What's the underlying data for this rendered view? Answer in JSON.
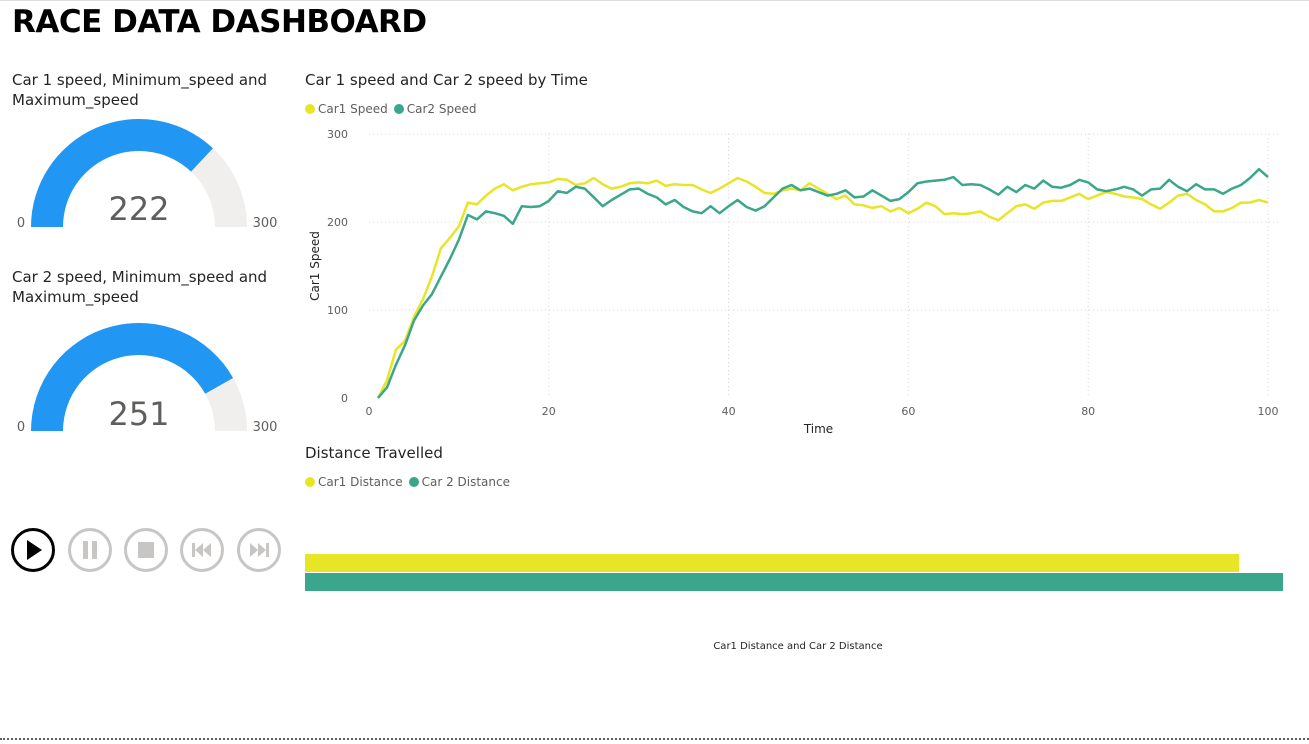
{
  "dashboard": {
    "title": "RACE DATA DASHBOARD"
  },
  "colors": {
    "gauge_fill": "#2196F3",
    "gauge_track": "#F0EFED",
    "car1": "#E8E526",
    "car2": "#3AA68B"
  },
  "gauge1": {
    "title": "Car 1 speed, Minimum_speed and Maximum_speed",
    "value": 222,
    "min": 0,
    "max": 300,
    "value_label": "222",
    "min_label": "0",
    "max_label": "300"
  },
  "gauge2": {
    "title": "Car 2 speed, Minimum_speed and Maximum_speed",
    "value": 251,
    "min": 0,
    "max": 300,
    "value_label": "251",
    "min_label": "0",
    "max_label": "300"
  },
  "speed_chart": {
    "title": "Car 1 speed and Car 2 speed by Time"
  },
  "distance_chart": {
    "title": "Distance Travelled",
    "caption": "Car1 Distance and Car 2 Distance"
  },
  "playback": {
    "buttons": [
      {
        "name": "play-button",
        "icon": "play-icon",
        "active": true
      },
      {
        "name": "pause-button",
        "icon": "pause-icon",
        "active": false
      },
      {
        "name": "stop-button",
        "icon": "stop-icon",
        "active": false
      },
      {
        "name": "previous-button",
        "icon": "skip-previous-icon",
        "active": false
      },
      {
        "name": "next-button",
        "icon": "skip-next-icon",
        "active": false
      }
    ]
  },
  "chart_data": [
    {
      "type": "line",
      "title": "Car 1 speed and Car 2 speed by Time",
      "xlabel": "Time",
      "ylabel": "Car1 Speed",
      "xlim": [
        0,
        100
      ],
      "ylim": [
        0,
        300
      ],
      "x_ticks": [
        0,
        20,
        40,
        60,
        80,
        100
      ],
      "y_ticks": [
        0,
        100,
        200,
        300
      ],
      "grid": true,
      "legend": "top-left",
      "series": [
        {
          "name": "Car1 Speed",
          "color": "#E8E526",
          "points": [
            [
              1,
              0
            ],
            [
              2,
              20
            ],
            [
              3,
              55
            ],
            [
              4,
              65
            ],
            [
              5,
              92
            ],
            [
              6,
              112
            ],
            [
              7,
              138
            ],
            [
              8,
              170
            ],
            [
              9,
              182
            ],
            [
              10,
              195
            ],
            [
              11,
              222
            ],
            [
              12,
              220
            ],
            [
              13,
              230
            ],
            [
              14,
              238
            ],
            [
              15,
              243
            ],
            [
              16,
              236
            ],
            [
              17,
              240
            ],
            [
              18,
              243
            ],
            [
              19,
              244
            ],
            [
              20,
              245
            ],
            [
              21,
              249
            ],
            [
              22,
              248
            ],
            [
              23,
              242
            ],
            [
              24,
              244
            ],
            [
              25,
              250
            ],
            [
              26,
              243
            ],
            [
              27,
              238
            ],
            [
              28,
              240
            ],
            [
              29,
              244
            ],
            [
              30,
              245
            ],
            [
              31,
              244
            ],
            [
              32,
              247
            ],
            [
              33,
              241
            ],
            [
              34,
              243
            ],
            [
              35,
              242
            ],
            [
              36,
              242
            ],
            [
              37,
              237
            ],
            [
              38,
              233
            ],
            [
              39,
              238
            ],
            [
              40,
              244
            ],
            [
              41,
              250
            ],
            [
              42,
              246
            ],
            [
              43,
              240
            ],
            [
              44,
              233
            ],
            [
              45,
              232
            ],
            [
              46,
              236
            ],
            [
              47,
              238
            ],
            [
              48,
              236
            ],
            [
              49,
              244
            ],
            [
              50,
              238
            ],
            [
              51,
              232
            ],
            [
              52,
              226
            ],
            [
              53,
              230
            ],
            [
              54,
              220
            ],
            [
              55,
              219
            ],
            [
              56,
              216
            ],
            [
              57,
              218
            ],
            [
              58,
              212
            ],
            [
              59,
              216
            ],
            [
              60,
              210
            ],
            [
              61,
              215
            ],
            [
              62,
              222
            ],
            [
              63,
              218
            ],
            [
              64,
              209
            ],
            [
              65,
              210
            ],
            [
              66,
              209
            ],
            [
              67,
              210
            ],
            [
              68,
              212
            ],
            [
              69,
              206
            ],
            [
              70,
              202
            ],
            [
              71,
              210
            ],
            [
              72,
              218
            ],
            [
              73,
              220
            ],
            [
              74,
              215
            ],
            [
              75,
              222
            ],
            [
              76,
              224
            ],
            [
              77,
              224
            ],
            [
              78,
              228
            ],
            [
              79,
              232
            ],
            [
              80,
              226
            ],
            [
              81,
              230
            ],
            [
              82,
              234
            ],
            [
              83,
              232
            ],
            [
              84,
              229
            ],
            [
              85,
              228
            ],
            [
              86,
              226
            ],
            [
              87,
              220
            ],
            [
              88,
              215
            ],
            [
              89,
              222
            ],
            [
              90,
              230
            ],
            [
              91,
              232
            ],
            [
              92,
              225
            ],
            [
              93,
              220
            ],
            [
              94,
              212
            ],
            [
              95,
              212
            ],
            [
              96,
              216
            ],
            [
              97,
              222
            ],
            [
              98,
              222
            ],
            [
              99,
              225
            ],
            [
              100,
              222
            ]
          ]
        },
        {
          "name": "Car2 Speed",
          "color": "#3AA68B",
          "points": [
            [
              1,
              0
            ],
            [
              2,
              12
            ],
            [
              3,
              38
            ],
            [
              4,
              60
            ],
            [
              5,
              88
            ],
            [
              6,
              105
            ],
            [
              7,
              118
            ],
            [
              8,
              138
            ],
            [
              9,
              158
            ],
            [
              10,
              180
            ],
            [
              11,
              208
            ],
            [
              12,
              203
            ],
            [
              13,
              212
            ],
            [
              14,
              210
            ],
            [
              15,
              207
            ],
            [
              16,
              198
            ],
            [
              17,
              218
            ],
            [
              18,
              217
            ],
            [
              19,
              218
            ],
            [
              20,
              224
            ],
            [
              21,
              235
            ],
            [
              22,
              233
            ],
            [
              23,
              240
            ],
            [
              24,
              238
            ],
            [
              25,
              228
            ],
            [
              26,
              218
            ],
            [
              27,
              225
            ],
            [
              28,
              231
            ],
            [
              29,
              237
            ],
            [
              30,
              238
            ],
            [
              31,
              232
            ],
            [
              32,
              228
            ],
            [
              33,
              220
            ],
            [
              34,
              225
            ],
            [
              35,
              217
            ],
            [
              36,
              212
            ],
            [
              37,
              210
            ],
            [
              38,
              218
            ],
            [
              39,
              210
            ],
            [
              40,
              218
            ],
            [
              41,
              225
            ],
            [
              42,
              217
            ],
            [
              43,
              213
            ],
            [
              44,
              218
            ],
            [
              45,
              228
            ],
            [
              46,
              238
            ],
            [
              47,
              242
            ],
            [
              48,
              236
            ],
            [
              49,
              238
            ],
            [
              50,
              234
            ],
            [
              51,
              230
            ],
            [
              52,
              232
            ],
            [
              53,
              236
            ],
            [
              54,
              228
            ],
            [
              55,
              229
            ],
            [
              56,
              236
            ],
            [
              57,
              230
            ],
            [
              58,
              224
            ],
            [
              59,
              226
            ],
            [
              60,
              234
            ],
            [
              61,
              244
            ],
            [
              62,
              246
            ],
            [
              63,
              247
            ],
            [
              64,
              248
            ],
            [
              65,
              251
            ],
            [
              66,
              242
            ],
            [
              67,
              243
            ],
            [
              68,
              242
            ],
            [
              69,
              237
            ],
            [
              70,
              231
            ],
            [
              71,
              240
            ],
            [
              72,
              234
            ],
            [
              73,
              242
            ],
            [
              74,
              238
            ],
            [
              75,
              247
            ],
            [
              76,
              240
            ],
            [
              77,
              239
            ],
            [
              78,
              242
            ],
            [
              79,
              248
            ],
            [
              80,
              245
            ],
            [
              81,
              237
            ],
            [
              82,
              235
            ],
            [
              83,
              237
            ],
            [
              84,
              240
            ],
            [
              85,
              237
            ],
            [
              86,
              230
            ],
            [
              87,
              237
            ],
            [
              88,
              238
            ],
            [
              89,
              248
            ],
            [
              90,
              240
            ],
            [
              91,
              235
            ],
            [
              92,
              243
            ],
            [
              93,
              237
            ],
            [
              94,
              237
            ],
            [
              95,
              232
            ],
            [
              96,
              238
            ],
            [
              97,
              242
            ],
            [
              98,
              250
            ],
            [
              99,
              260
            ],
            [
              100,
              251
            ]
          ]
        }
      ]
    },
    {
      "type": "bar",
      "orientation": "horizontal",
      "title": "Distance Travelled",
      "caption": "Car1 Distance and Car 2 Distance",
      "legend": "top-left",
      "series": [
        {
          "name": "Car1 Distance",
          "color": "#E8E526",
          "value": 0.955
        },
        {
          "name": "Car 2 Distance",
          "color": "#3AA68B",
          "value": 1.0
        }
      ]
    }
  ]
}
